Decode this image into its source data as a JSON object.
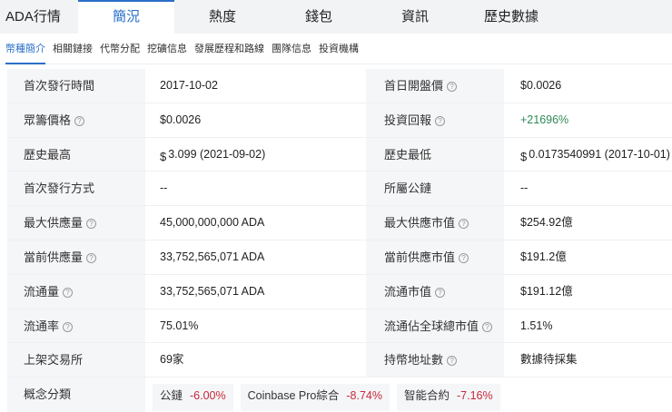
{
  "tabs": [
    "ADA行情",
    "簡況",
    "熱度",
    "錢包",
    "資訊",
    "歷史數據"
  ],
  "subtabs": [
    "幣種簡介",
    "相關鏈接",
    "代幣分配",
    "挖礦信息",
    "發展歷程和路線",
    "團隊信息",
    "投資機構"
  ],
  "rows": [
    {
      "l": "首次發行時間",
      "lq": false,
      "v": "2017-10-02",
      "r": "首日開盤價",
      "rq": true,
      "rv": "$0.0026"
    },
    {
      "l": "眾籌價格",
      "lq": true,
      "v": "$0.0026",
      "r": "投資回報",
      "rq": true,
      "rv": "+21696%"
    },
    {
      "l": "歷史最高",
      "lq": false,
      "v": "3.099 (2021-09-02)",
      "r": "歷史最低",
      "rq": false,
      "rv": "0.0173540991 (2017-10-01)"
    },
    {
      "l": "首次發行方式",
      "lq": false,
      "v": "--",
      "r": "所屬公鏈",
      "rq": false,
      "rv": "--"
    },
    {
      "l": "最大供應量",
      "lq": true,
      "v": "45,000,000,000 ADA",
      "r": "最大供應市值",
      "rq": true,
      "rv": "$254.92億"
    },
    {
      "l": "當前供應量",
      "lq": true,
      "v": "33,752,565,071 ADA",
      "r": "當前供應市值",
      "rq": true,
      "rv": "$191.2億"
    },
    {
      "l": "流通量",
      "lq": true,
      "v": "33,752,565,071 ADA",
      "r": "流通市值",
      "rq": true,
      "rv": "$191.12億"
    },
    {
      "l": "流通率",
      "lq": true,
      "v": "75.01%",
      "r": "流通佔全球總市值",
      "rq": true,
      "rv": "1.51%"
    },
    {
      "l": "上架交易所",
      "lq": false,
      "v": "69家",
      "r": "持幣地址數",
      "rq": true,
      "rv": "數據待採集"
    }
  ],
  "currency_symbol": "$",
  "question_mark": "?",
  "concepts": {
    "label": "概念分類",
    "items": [
      {
        "name": "公鏈",
        "change": "-6.00%"
      },
      {
        "name": "Coinbase Pro綜合",
        "change": "-8.74%"
      },
      {
        "name": "智能合約",
        "change": "-7.16%"
      }
    ]
  },
  "colors": {
    "accent": "#2a6fc9",
    "positive": "#2e8a57",
    "negative": "#c8283a"
  }
}
